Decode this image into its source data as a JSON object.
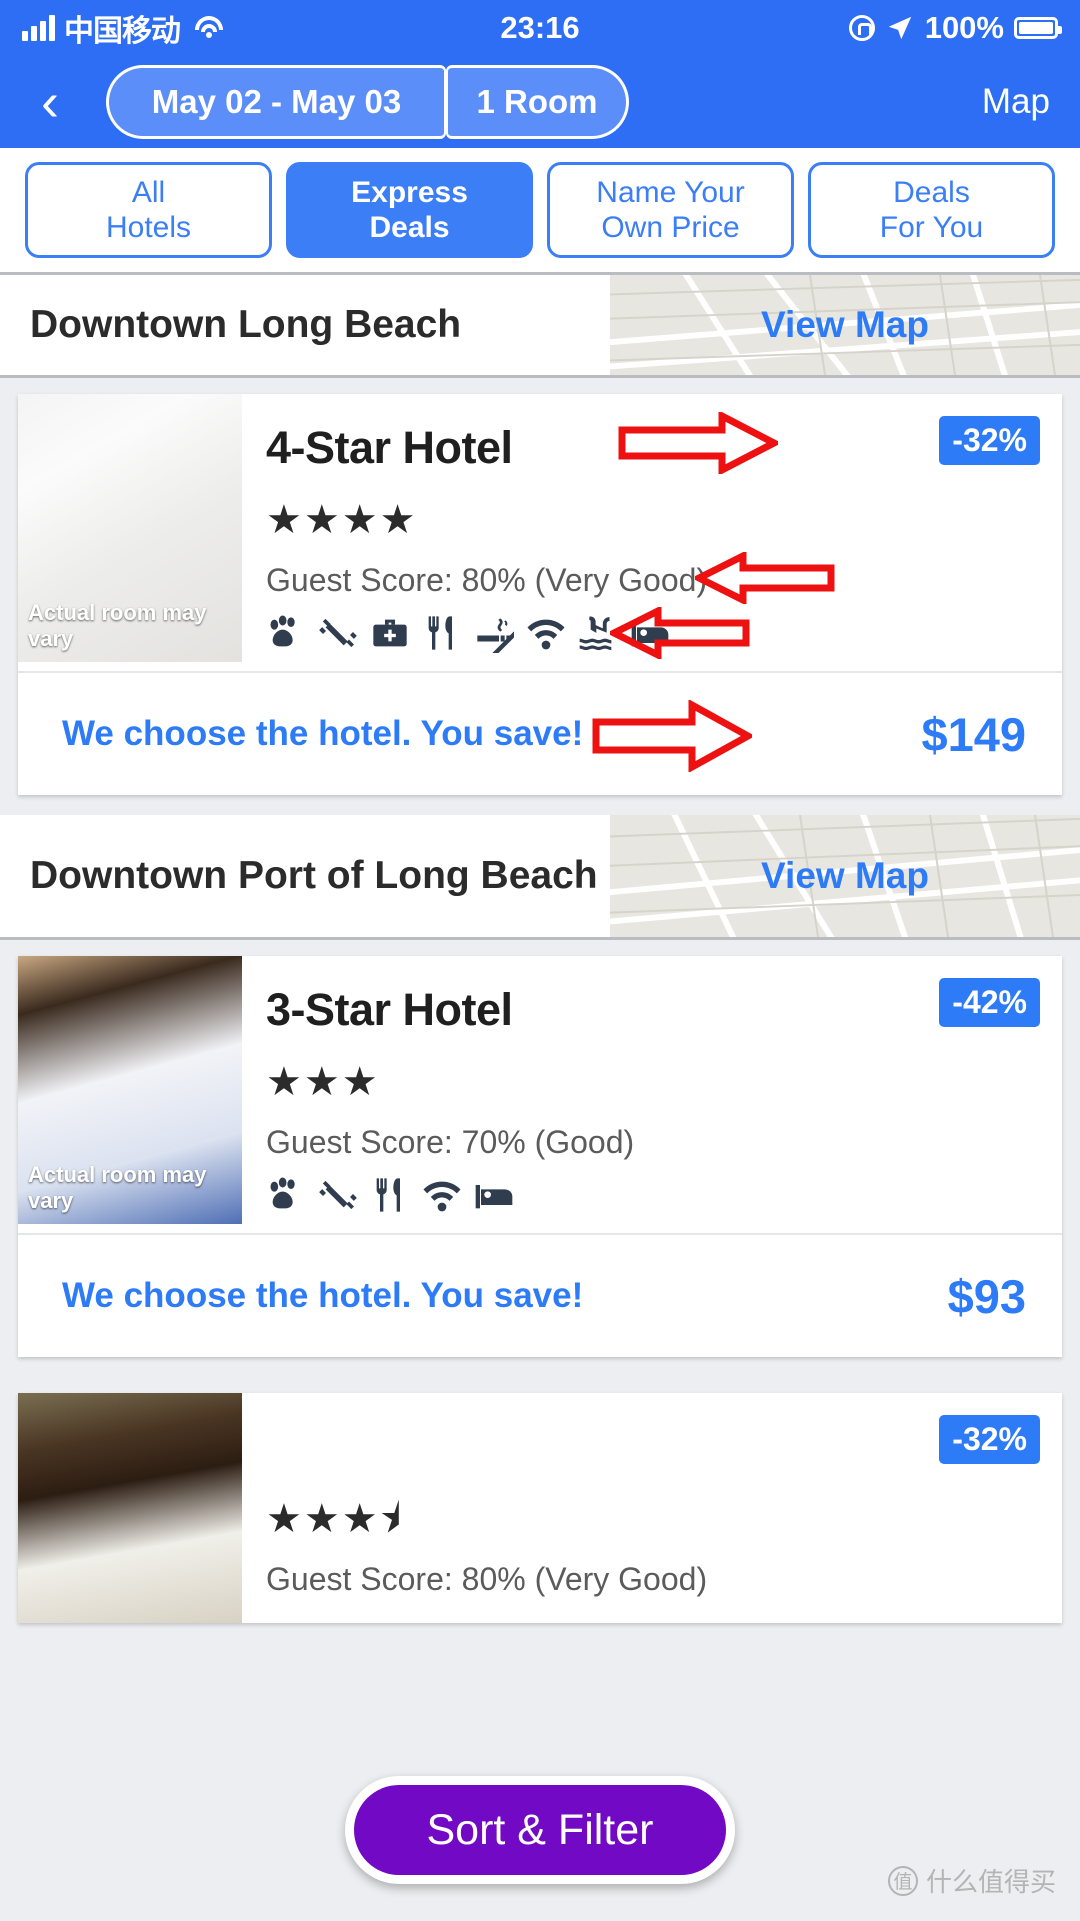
{
  "status_bar": {
    "carrier": "中国移动",
    "time": "23:16",
    "battery_percent": "100%",
    "icons": [
      "signal-icon",
      "wifi-icon",
      "lock-rotation-icon",
      "location-arrow-icon",
      "battery-icon"
    ]
  },
  "nav": {
    "back_label": "‹",
    "dates": "May 02 - May 03",
    "rooms": "1 Room",
    "map_label": "Map"
  },
  "tabs": [
    {
      "label_line1": "All",
      "label_line2": "Hotels",
      "active": false
    },
    {
      "label_line1": "Express",
      "label_line2": "Deals",
      "active": true
    },
    {
      "label_line1": "Name Your",
      "label_line2": "Own Price",
      "active": false
    },
    {
      "label_line1": "Deals",
      "label_line2": "For You",
      "active": false
    }
  ],
  "view_map_label": "View Map",
  "sections": [
    {
      "title": "Downtown Long Beach",
      "hotel": {
        "name": "4-Star Hotel",
        "stars": "★★★★",
        "discount": "-32%",
        "guest_score": "Guest Score: 80% (Very Good)",
        "image_caption": "Actual room may vary",
        "amenities": [
          "pet-friendly-icon",
          "fitness-icon",
          "business-center-icon",
          "restaurant-icon",
          "no-smoking-icon",
          "wifi-icon",
          "pool-icon",
          "bed-icon"
        ],
        "save_text": "We choose the hotel. You save!",
        "price": "$149"
      }
    },
    {
      "title": "Downtown Port of Long Beach",
      "hotel": {
        "name": "3-Star Hotel",
        "stars": "★★★",
        "discount": "-42%",
        "guest_score": "Guest Score: 70% (Good)",
        "image_caption": "Actual room may vary",
        "amenities": [
          "pet-friendly-icon",
          "fitness-icon",
          "restaurant-icon",
          "wifi-icon",
          "bed-icon"
        ],
        "save_text": "We choose the hotel. You save!",
        "price": "$93"
      }
    }
  ],
  "partial_card": {
    "discount": "-32%",
    "stars": "★★★⯨",
    "guest_score": "Guest Score: 80% (Very Good)"
  },
  "sort_filter_label": "Sort & Filter",
  "watermark": {
    "mark": "值",
    "text": "什么值得买"
  },
  "colors": {
    "brand_blue": "#2d6ef5",
    "accent_blue": "#2d7bf6",
    "badge_blue": "#2d7bf6",
    "sort_filter_purple": "#7209c4",
    "annotation_red": "#ee1111"
  }
}
